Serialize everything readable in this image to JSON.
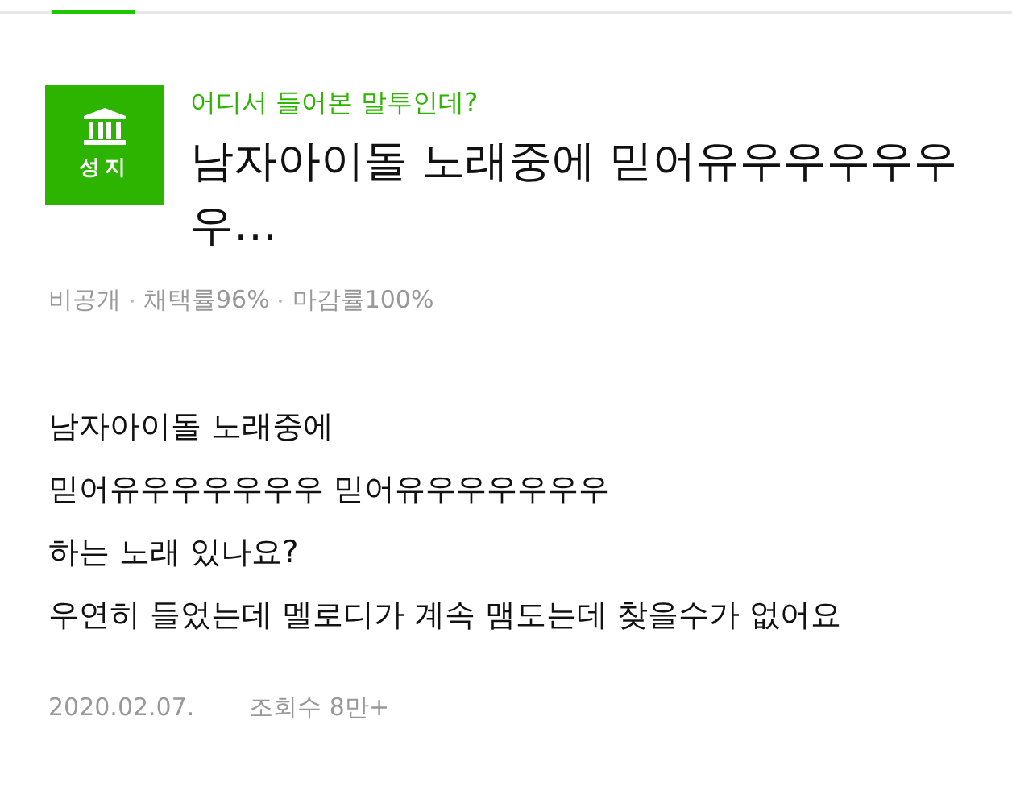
{
  "badge": {
    "label": "성지"
  },
  "category": "어디서 들어본 말투인데?",
  "title": "남자아이돌 노래중에 믿어유우우우우우우…",
  "meta": [
    "비공개",
    "채택률96%",
    "마감률100%"
  ],
  "body": [
    "남자아이돌 노래중에",
    "믿어유우우우우우우 믿어유우우우우우우",
    "하는 노래 있나요?",
    "우연히 들었는데 멜로디가 계속 맴도는데 찾을수가 없어요"
  ],
  "date": "2020.02.07.",
  "views": "조회수 8만+"
}
